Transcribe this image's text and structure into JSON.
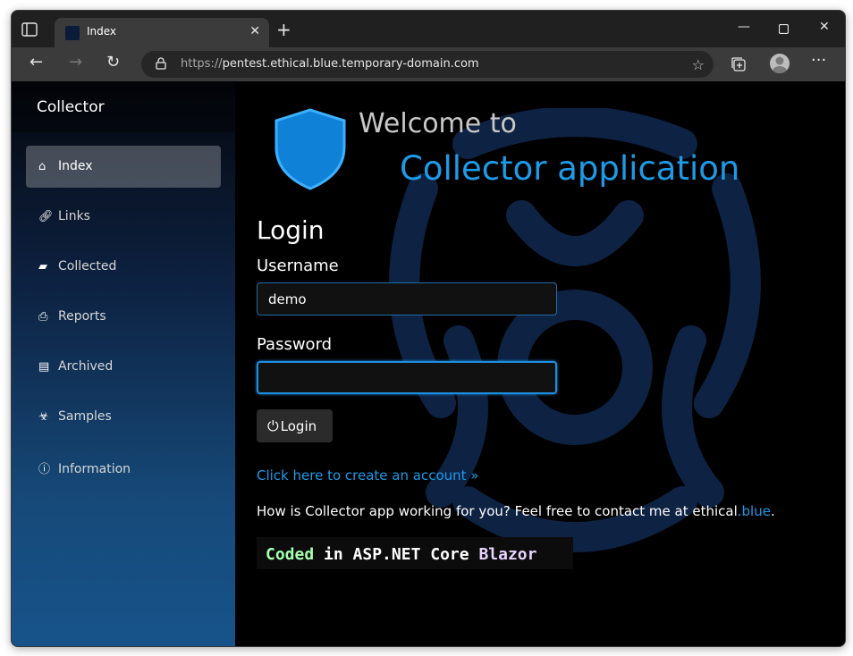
{
  "browser": {
    "tab_title": "Index",
    "url_scheme": "https://",
    "url_host": "pentest.ethical.blue.temporary-domain.com"
  },
  "sidebar": {
    "brand": "Collector",
    "items": [
      {
        "label": "Index",
        "icon": "home-icon",
        "active": true
      },
      {
        "label": "Links",
        "icon": "link-icon"
      },
      {
        "label": "Collected",
        "icon": "folder-icon"
      },
      {
        "label": "Reports",
        "icon": "printer-icon"
      },
      {
        "label": "Archived",
        "icon": "archive-icon"
      },
      {
        "label": "Samples",
        "icon": "biohazard-icon"
      },
      {
        "label": "Information",
        "icon": "info-icon"
      }
    ]
  },
  "main": {
    "welcome": "Welcome to",
    "app_title": "Collector application",
    "login_title": "Login",
    "username_label": "Username",
    "username_value": "demo",
    "password_label": "Password",
    "password_value": "",
    "login_button": "Login",
    "create_account_link": "Click here to create an account »",
    "contact_text": "How is Collector app working for you? Feel free to contact me at ethical",
    "contact_highlight": ".blue",
    "contact_end": ".",
    "coded_1": "Coded",
    "coded_2": "in ASP.NET Core",
    "coded_3": "Blazor"
  },
  "colors": {
    "accent": "#1e9be8",
    "sidebar_bottom": "#17538a",
    "page_bg": "#000000"
  }
}
